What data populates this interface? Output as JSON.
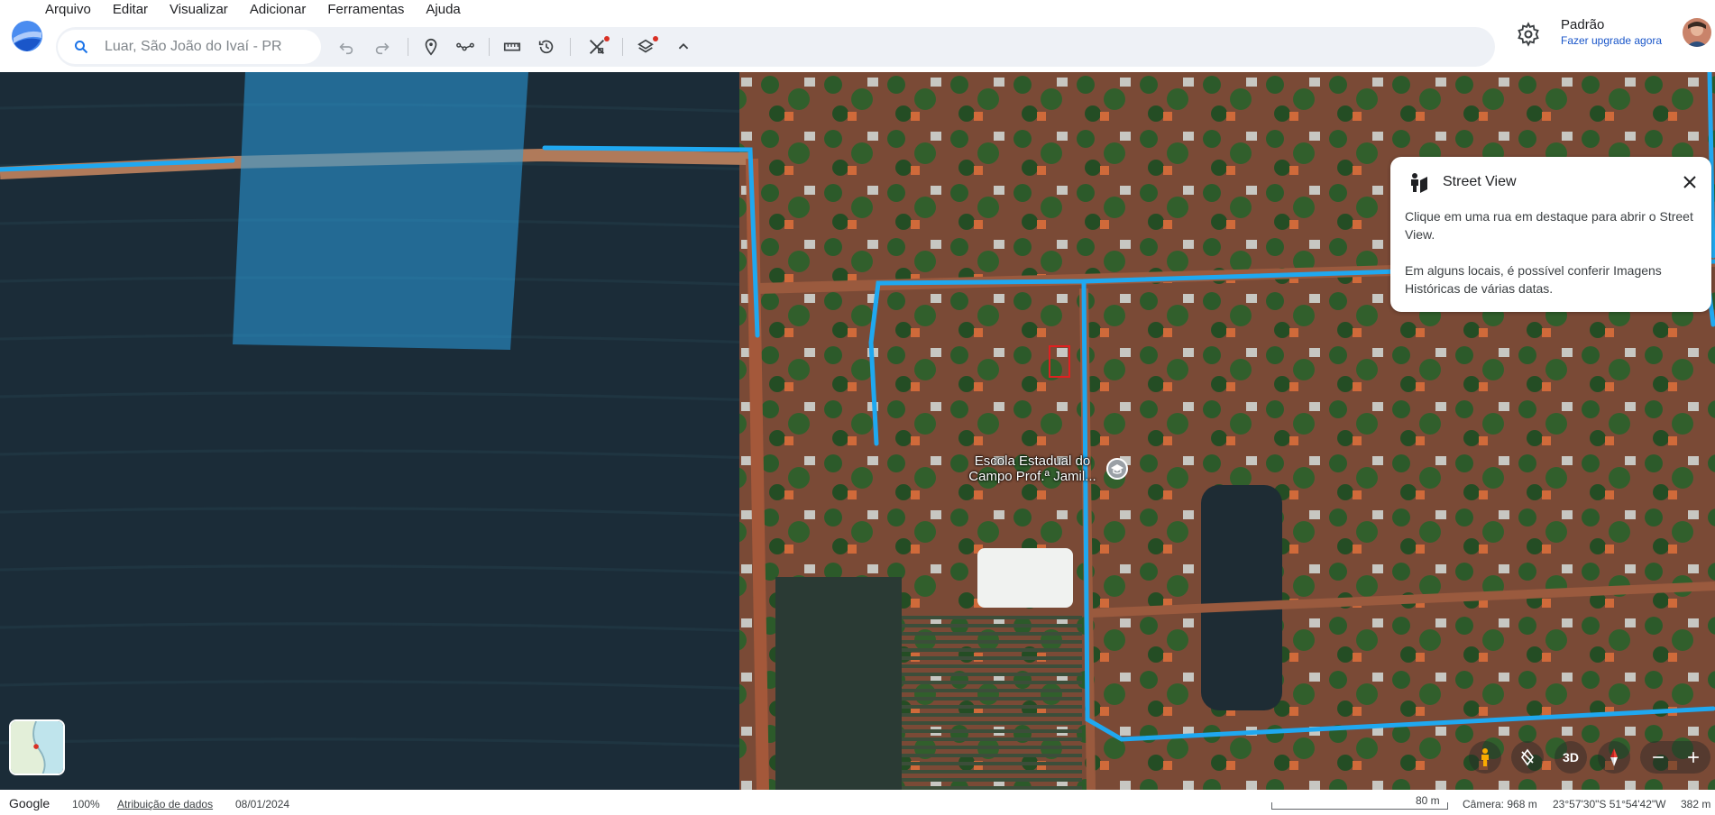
{
  "app": {
    "menu": [
      "Arquivo",
      "Editar",
      "Visualizar",
      "Adicionar",
      "Ferramentas",
      "Ajuda"
    ]
  },
  "search": {
    "placeholder": "Luar, São João do Ivaí - PR"
  },
  "toolbar": {
    "icons": [
      "undo-icon",
      "redo-icon",
      "placemark-icon",
      "path-icon",
      "ruler-icon",
      "historical-imagery-icon",
      "projects-icon",
      "layers-icon",
      "collapse-chevron-icon"
    ]
  },
  "profile": {
    "name": "Padrão",
    "upgrade": "Fazer upgrade agora"
  },
  "map": {
    "place_label_line1": "Escola Estadual do",
    "place_label_line2": "Campo Prof.ª Jamil..."
  },
  "street_view": {
    "title": "Street View",
    "text1": "Clique em uma rua em destaque para abrir o Street View.",
    "text2": "Em alguns locais, é possível conferir Imagens Históricas de várias datas."
  },
  "controls": {
    "btn_3d": "3D"
  },
  "status": {
    "google": "Google",
    "zoom": "100%",
    "attribution": "Atribuição de dados",
    "date": "08/01/2024",
    "scale": "80 m",
    "camera": "Câmera: 968 m",
    "coords": "23°57'30\"S 51°54'42\"W",
    "altitude": "382 m"
  },
  "colors": {
    "accent": "#1a73e8",
    "street_view_line": "#1fa8f0",
    "link": "#1a56c9"
  }
}
